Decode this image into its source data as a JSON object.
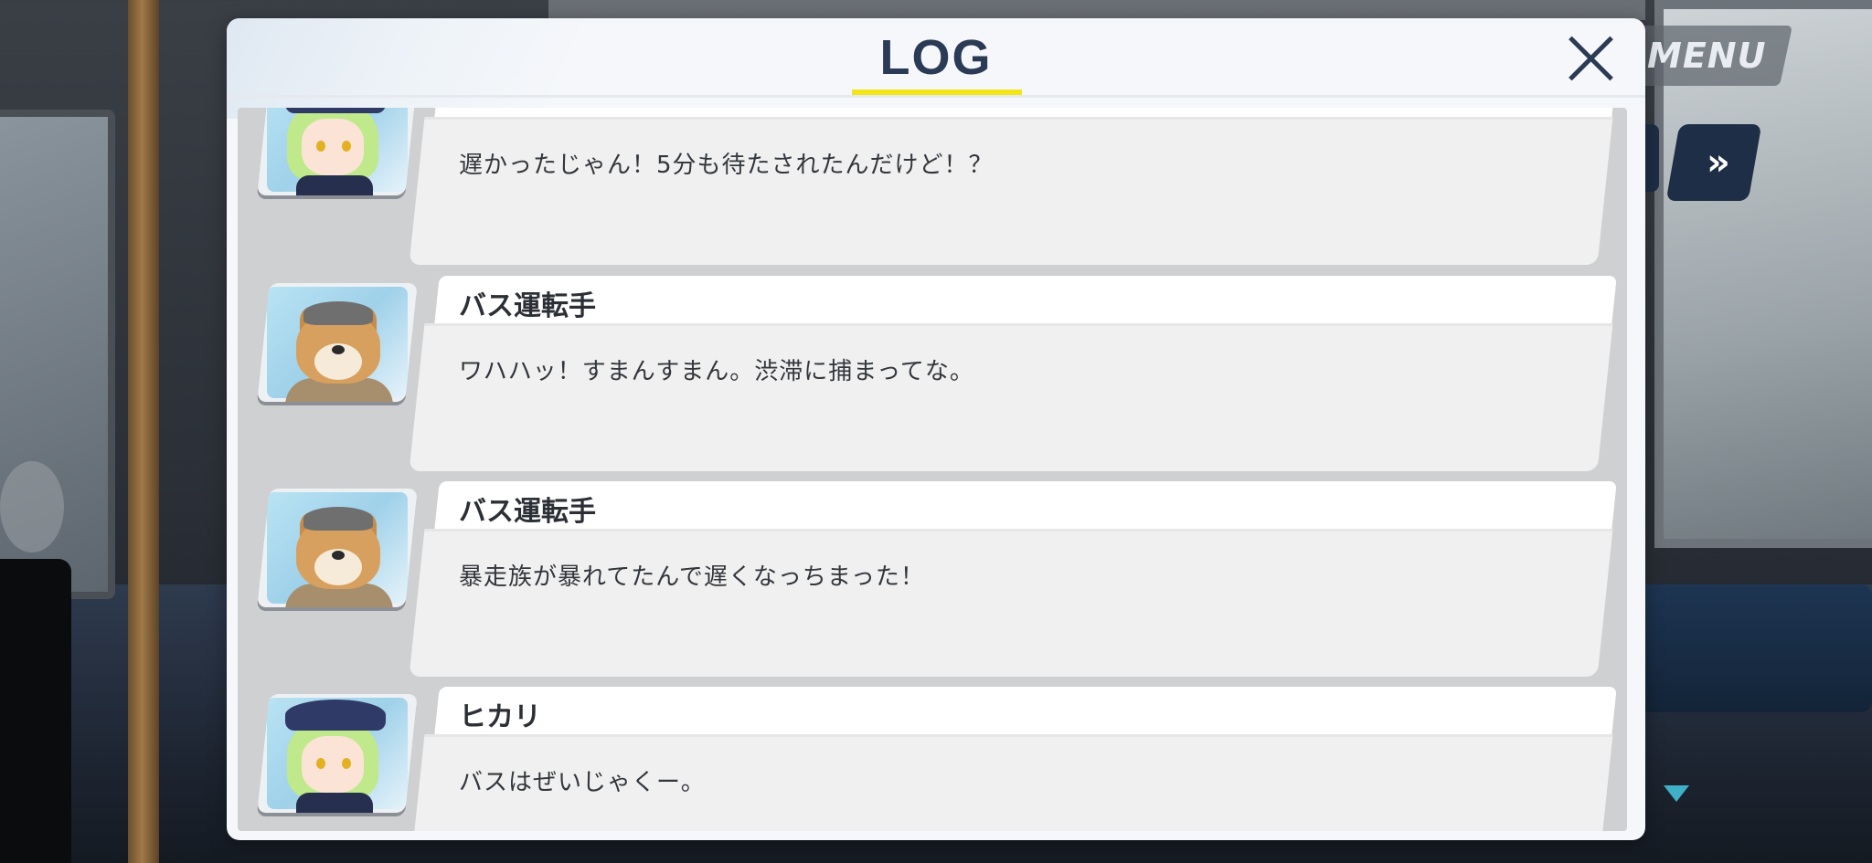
{
  "hud": {
    "menu_label": "MENU",
    "skip_label": "»"
  },
  "log": {
    "title": "LOG",
    "entries": [
      {
        "speaker": "",
        "portrait": "hikari-portrait",
        "text": "遅かったじゃん！5分も待たされたんだけど！？"
      },
      {
        "speaker": "バス運転手",
        "portrait": "bus-driver-portrait",
        "text": "ワハハッ！すまんすまん。渋滞に捕まってな。"
      },
      {
        "speaker": "バス運転手",
        "portrait": "bus-driver-portrait",
        "text": "暴走族が暴れてたんで遅くなっちまった！"
      },
      {
        "speaker": "ヒカリ",
        "portrait": "hikari-portrait",
        "text": "バスはぜいじゃくー。"
      }
    ]
  },
  "colors": {
    "panel_bg": "#f5f7fa",
    "title_text": "#2b3a55",
    "title_underline": "#f2e61a",
    "hud_dark_button": "#1e2e46",
    "next_indicator": "#3fb0c8"
  }
}
